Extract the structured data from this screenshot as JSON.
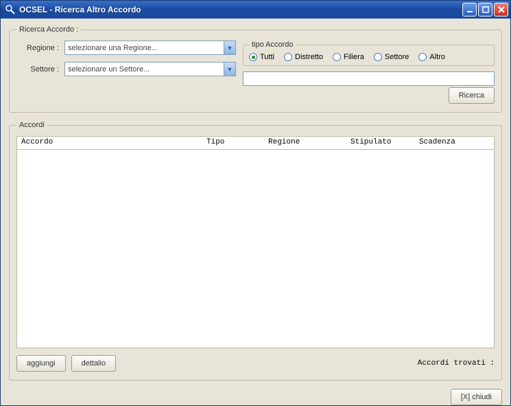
{
  "window": {
    "title": "OCSEL - Ricerca Altro Accordo"
  },
  "searchGroup": {
    "legend": "Ricerca Accordo  :",
    "regione": {
      "label": "Regione :",
      "value": "selezionare una Regione..."
    },
    "settore": {
      "label": "Settore :",
      "value": "selezionare un Settore..."
    },
    "filterValue": "",
    "button": "Ricerca"
  },
  "tipoGroup": {
    "legend": "tipo Accordo",
    "options": [
      "Tutti",
      "Distretto",
      "Filiera",
      "Settore",
      "Altro"
    ],
    "selected": "Tutti"
  },
  "accordiGroup": {
    "legend": "Accordi",
    "columns": {
      "accordo": "Accordo",
      "tipo": "Tipo",
      "regione": "Regione",
      "stipulato": "Stipulato",
      "scadenza": "Scadenza"
    },
    "addBtn": "aggiungi",
    "detailBtn": "dettalio",
    "foundLabel": "Accordi trovati :"
  },
  "footer": {
    "close": "[X] chiudi"
  }
}
